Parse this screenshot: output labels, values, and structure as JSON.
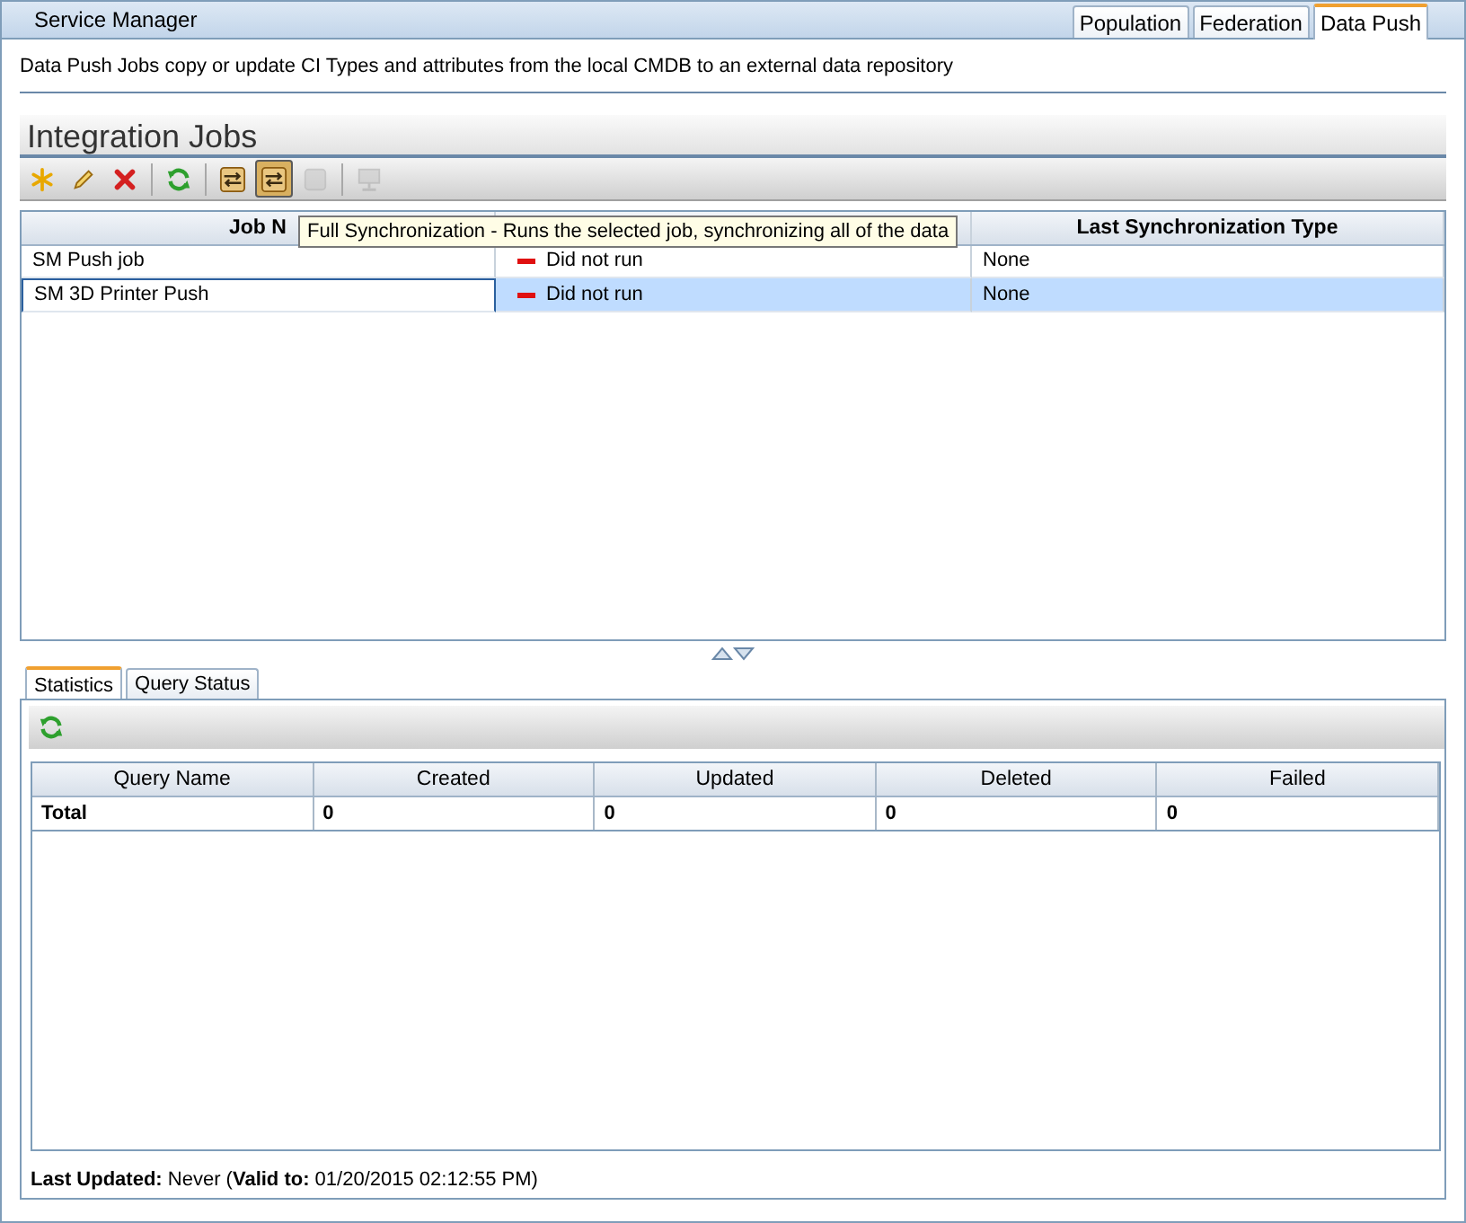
{
  "header": {
    "title": "Service Manager",
    "tabs": [
      {
        "label": "Population",
        "selected": false
      },
      {
        "label": "Federation",
        "selected": false
      },
      {
        "label": "Data Push",
        "selected": true
      }
    ]
  },
  "description": "Data Push Jobs copy or update CI Types and attributes from the local CMDB to an external data repository",
  "jobs": {
    "title": "Integration Jobs",
    "toolbar": [
      {
        "kind": "new",
        "pressed": false,
        "disabled": false
      },
      {
        "kind": "edit",
        "pressed": false,
        "disabled": false
      },
      {
        "kind": "delete",
        "pressed": false,
        "disabled": false
      },
      {
        "kind": "refresh",
        "pressed": false,
        "disabled": false
      },
      {
        "kind": "sync",
        "pressed": false,
        "disabled": false
      },
      {
        "kind": "sync",
        "pressed": true,
        "disabled": false
      },
      {
        "kind": "stop",
        "pressed": false,
        "disabled": true
      },
      {
        "kind": "monitor",
        "pressed": false,
        "disabled": true
      }
    ],
    "tooltip": "Full Synchronization - Runs the selected job, synchronizing all of the data",
    "columns": [
      "Job N",
      "Last Synchronization Type"
    ],
    "rows": [
      {
        "name": "SM Push job",
        "status": "Did not run",
        "kind": "not_run",
        "sync_type": "None",
        "selected": false
      },
      {
        "name": "SM 3D Printer Push",
        "status": "Did not run",
        "kind": "not_run",
        "sync_type": "None",
        "selected": true
      }
    ]
  },
  "details": {
    "tabs": [
      {
        "label": "Statistics",
        "selected": true
      },
      {
        "label": "Query Status",
        "selected": false
      }
    ],
    "columns": [
      "Query Name",
      "Created",
      "Updated",
      "Deleted",
      "Failed"
    ],
    "rows": [
      [
        "Total",
        "0",
        "0",
        "0",
        "0"
      ]
    ],
    "footer": "**Last Updated:** Never (**Valid to:** 01/20/2015 02:12:55 PM)"
  }
}
